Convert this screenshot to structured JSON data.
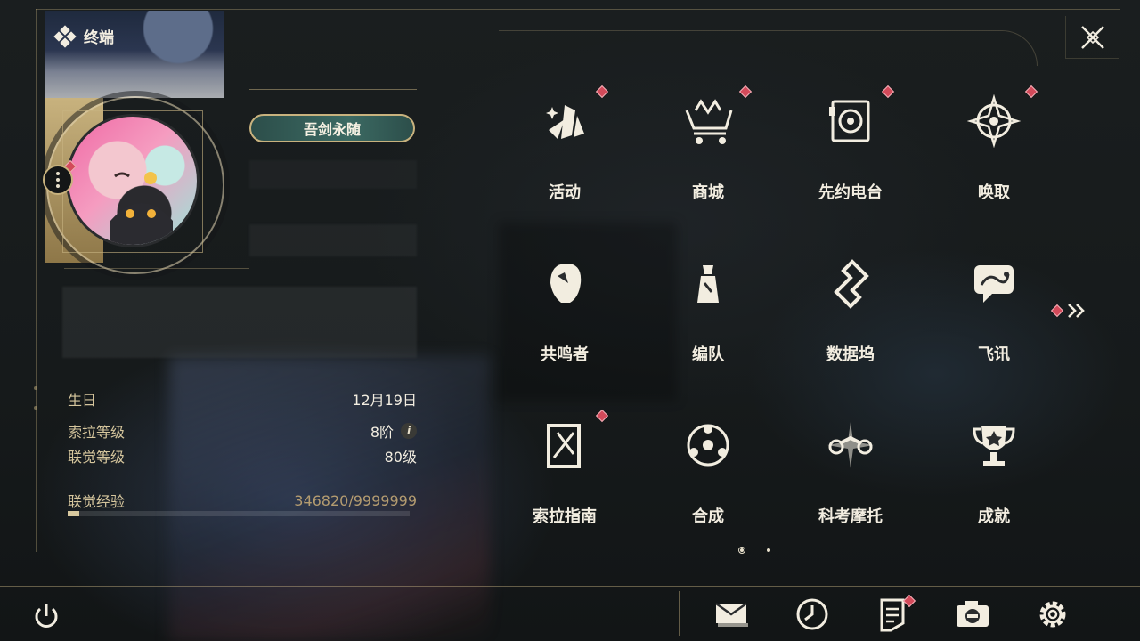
{
  "header": {
    "title": "终端"
  },
  "profile": {
    "title_badge": "吾剑永随",
    "stats": [
      {
        "label": "生日",
        "value": "12月19日"
      },
      {
        "label": "索拉等级",
        "value": "8阶"
      },
      {
        "label": "联觉等级",
        "value": "80级"
      }
    ],
    "exp": {
      "label": "联觉经验",
      "value": "346820/9999999",
      "progress": 0.0347
    }
  },
  "menu": [
    {
      "label": "活动",
      "icon": "event-icon",
      "badge": true
    },
    {
      "label": "商城",
      "icon": "shop-cart-icon",
      "badge": true
    },
    {
      "label": "先约电台",
      "icon": "radio-icon",
      "badge": true
    },
    {
      "label": "唤取",
      "icon": "convene-compass-icon",
      "badge": true
    },
    {
      "label": "共鸣者",
      "icon": "resonator-head-icon",
      "badge": false
    },
    {
      "label": "编队",
      "icon": "team-chess-icon",
      "badge": false
    },
    {
      "label": "数据坞",
      "icon": "data-dock-icon",
      "badge": false
    },
    {
      "label": "飞讯",
      "icon": "chat-bubble-icon",
      "badge": false
    },
    {
      "label": "索拉指南",
      "icon": "guide-book-icon",
      "badge": true
    },
    {
      "label": "合成",
      "icon": "synthesis-icon",
      "badge": false
    },
    {
      "label": "科考摩托",
      "icon": "motorbike-icon",
      "badge": false
    },
    {
      "label": "成就",
      "icon": "trophy-icon",
      "badge": false
    }
  ],
  "pager": {
    "pages": 2,
    "current": 1
  },
  "bottom_bar": [
    {
      "name": "mail",
      "icon": "mail-icon",
      "badge": false
    },
    {
      "name": "clock",
      "icon": "clock-icon",
      "badge": false
    },
    {
      "name": "notes",
      "icon": "notes-icon",
      "badge": true
    },
    {
      "name": "camera",
      "icon": "camera-icon",
      "badge": false
    },
    {
      "name": "settings",
      "icon": "gear-icon",
      "badge": false
    }
  ],
  "colors": {
    "accent": "#c8b27e",
    "badge": "#d34a5a",
    "text": "#f2ede0"
  }
}
